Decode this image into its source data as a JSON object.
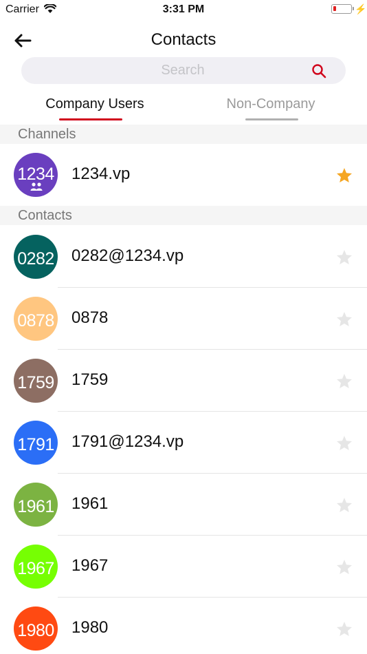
{
  "status_bar": {
    "carrier": "Carrier",
    "time": "3:31 PM"
  },
  "header": {
    "title": "Contacts"
  },
  "search": {
    "placeholder": "Search"
  },
  "tabs": [
    {
      "label": "Company Users",
      "active": true
    },
    {
      "label": "Non-Company",
      "active": false
    }
  ],
  "channels": {
    "header": "Channels",
    "items": [
      {
        "avatar_text": "1234",
        "name": "1234.vp",
        "color": "#6a3fbf",
        "favorite": true
      }
    ]
  },
  "contacts": {
    "header": "Contacts",
    "items": [
      {
        "avatar_text": "0282",
        "name": "0282@1234.vp",
        "color": "#05625f",
        "favorite": false
      },
      {
        "avatar_text": "0878",
        "name": "0878",
        "color": "#ffc680",
        "favorite": false
      },
      {
        "avatar_text": "1759",
        "name": "1759",
        "color": "#8d6e63",
        "favorite": false
      },
      {
        "avatar_text": "1791",
        "name": "1791@1234.vp",
        "color": "#2b6ef6",
        "favorite": false
      },
      {
        "avatar_text": "1961",
        "name": "1961",
        "color": "#7cb342",
        "favorite": false
      },
      {
        "avatar_text": "1967",
        "name": "1967",
        "color": "#76ff03",
        "favorite": false
      },
      {
        "avatar_text": "1980",
        "name": "1980",
        "color": "#ff4a12",
        "favorite": false
      }
    ]
  },
  "colors": {
    "accent": "#d0021b",
    "favorite_star": "#f5a623",
    "inactive_star": "#e6e6e6"
  }
}
